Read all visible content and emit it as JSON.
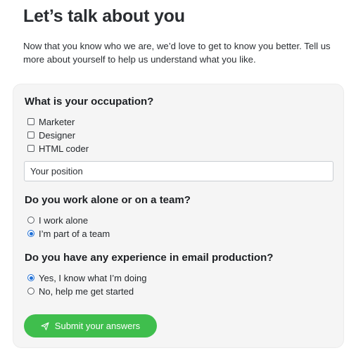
{
  "page": {
    "title": "Let’s talk about you",
    "intro": "Now that you know who we are, we’d love to get to know you better. Tell us more about yourself to help us understand what you like."
  },
  "form": {
    "occupation": {
      "question": "What is your occupation?",
      "options": [
        {
          "label": "Marketer",
          "checked": false
        },
        {
          "label": "Designer",
          "checked": false
        },
        {
          "label": "HTML coder",
          "checked": false
        }
      ],
      "position_placeholder": "Your position"
    },
    "team": {
      "question": "Do you work alone or on a team?",
      "options": [
        {
          "label": "I work alone",
          "checked": false
        },
        {
          "label": "I’m part of a team",
          "checked": true
        }
      ]
    },
    "experience": {
      "question": "Do you have any experience in email production?",
      "options": [
        {
          "label": "Yes, I know what I’m doing",
          "checked": true
        },
        {
          "label": "No, help me get started",
          "checked": false
        }
      ]
    },
    "submit": {
      "label": "Submit your answers",
      "icon": "send-icon",
      "color": "#3fbe4d"
    }
  }
}
